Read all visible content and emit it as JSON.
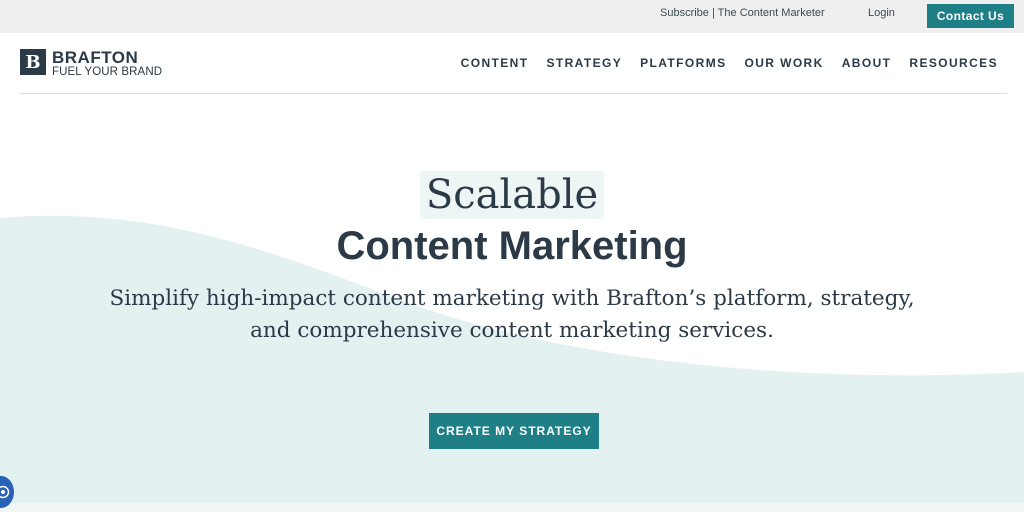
{
  "utility_bar": {
    "subscribe_link": "Subscribe | The Content Marketer",
    "login_link": "Login",
    "contact_button": "Contact Us"
  },
  "header": {
    "logo": {
      "mark": "B",
      "name": "BRAFTON",
      "tagline": "FUEL YOUR BRAND"
    },
    "nav": [
      "CONTENT",
      "STRATEGY",
      "PLATFORMS",
      "OUR WORK",
      "ABOUT",
      "RESOURCES"
    ]
  },
  "hero": {
    "title_light": "Scalable",
    "title_bold": "Content Marketing",
    "subtitle": "Simplify high-impact content marketing with Brafton’s platform, strategy, and comprehensive content marketing services.",
    "cta_button": "CREATE MY STRATEGY"
  },
  "accessibility": {
    "icon": "accessibility-icon"
  },
  "colors": {
    "accent": "#1f7f86",
    "text": "#2b3a46",
    "wave": "#e3f1f1",
    "utility_bar": "#efefef"
  }
}
